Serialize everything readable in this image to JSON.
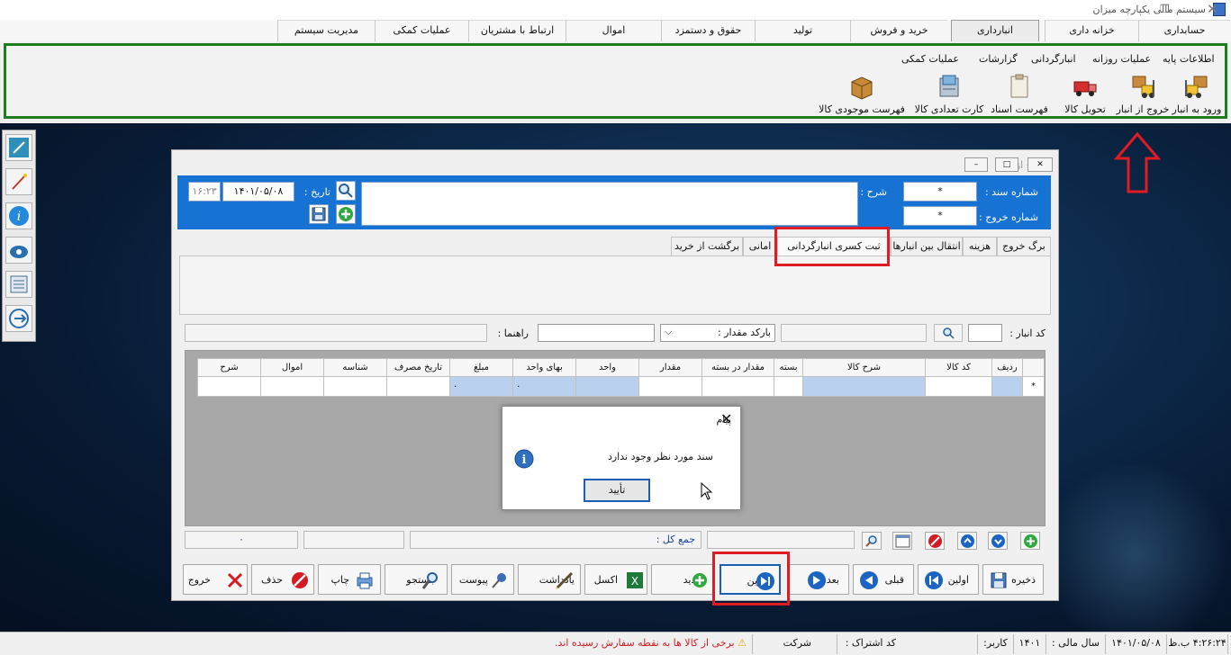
{
  "window": {
    "title": "سیستم مالی یکپارچه میزان"
  },
  "main_menu": {
    "items": [
      "حسابداری",
      "خزانه داری",
      "انبارداری",
      "خرید و فروش",
      "تولید",
      "حقوق و دستمزد",
      "اموال",
      "ارتباط با مشتریان",
      "عملیات کمکی",
      "مدیریت سیستم"
    ],
    "active": "انبارداری"
  },
  "ribbon": {
    "subtabs": [
      "اطلاعات پایه",
      "عملیات روزانه",
      "انبارگردانی",
      "گزارشات",
      "عملیات کمکی"
    ],
    "tools": [
      "ورود به انبار",
      "خروج از انبار",
      "تحویل کالا",
      "فهرست اسناد",
      "کارت تعدادی کالا",
      "فهرست موجودی کالا"
    ]
  },
  "sidebar": {
    "icons": [
      "resize-icon",
      "wand-icon",
      "info-icon",
      "phone-icon",
      "notes-icon",
      "logout-icon"
    ]
  },
  "form": {
    "title": "خروج از انبار",
    "doc_number_label": "شماره سند :",
    "doc_number_value": "*",
    "exit_number_label": "شماره خروج :",
    "exit_number_value": "*",
    "description_label": "شرح :",
    "date_label": "تاریخ :",
    "date_value": "۱۴۰۱/۰۵/۰۸",
    "time_value": "۱۶:۲۳"
  },
  "tabs": {
    "items": [
      "برگ خروج",
      "هزینه",
      "انتقال بین انبارها",
      "ثبت کسری انبارگردانی",
      "امانی",
      "برگشت از خرید"
    ],
    "active": "ثبت کسری انبارگردانی"
  },
  "filters": {
    "warehouse_code_label": "کد انبار :",
    "barcode_select": "بارکد مقدار :",
    "guide_label": "راهنما :"
  },
  "grid": {
    "columns": [
      "ردیف",
      "کد کالا",
      "شرح کالا",
      "بسته",
      "مقدار در بسته",
      "مقدار",
      "واحد",
      "بهای واحد",
      "مبلغ",
      "تاریخ مصرف",
      "شناسه",
      "اموال",
      "شرح"
    ],
    "new_row_marker": "*",
    "unit_price": "۰",
    "amount": "۰"
  },
  "totals": {
    "label": "جمع کل :",
    "value": "۰"
  },
  "actions": [
    "ذخیره",
    "اولین",
    "قبلی",
    "بعدی",
    "آخرین",
    "جدید",
    "اکسل",
    "یادداشت",
    "پیوست",
    "جستجو",
    "چاپ",
    "حذف",
    "خروج"
  ],
  "dialog": {
    "title": "پیام",
    "message": "سند مورد نظر وجود ندارد",
    "ok": "تأیید"
  },
  "statusbar": {
    "time": "۴:۲۶:۲۴ ب.ظ",
    "date": "۱۴۰۱/۰۵/۰۸",
    "fiscal_year_label": "سال مالی :",
    "fiscal_year": "۱۴۰۱",
    "user_label": "کاربر:",
    "subscription_label": "کد اشتراک :",
    "company_label": "شرکت",
    "warning": "برخی از کالا ها به نقطه سفارش رسیده اند."
  },
  "colors": {
    "accent": "#1673d4",
    "highlight": "#e01b24",
    "ribbon_border": "#1e7e1e"
  }
}
